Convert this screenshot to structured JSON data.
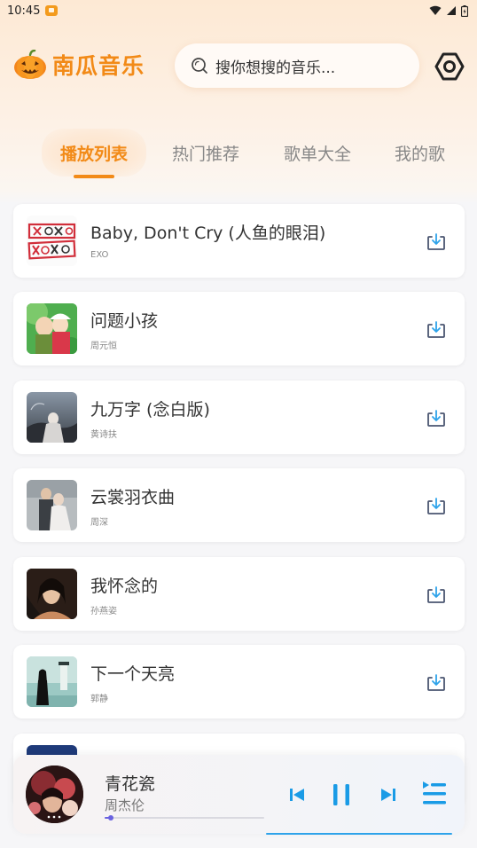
{
  "status_bar": {
    "time": "10:45"
  },
  "app": {
    "name": "南瓜音乐"
  },
  "search": {
    "placeholder": "搜你想搜的音乐..."
  },
  "tabs": [
    {
      "label": "播放列表",
      "active": true
    },
    {
      "label": "热门推荐",
      "active": false
    },
    {
      "label": "歌单大全",
      "active": false
    },
    {
      "label": "我的歌",
      "active": false
    }
  ],
  "songs": [
    {
      "title": "Baby, Don't Cry (人鱼的眼泪)",
      "artist": "EXO"
    },
    {
      "title": "问题小孩",
      "artist": "周元恒"
    },
    {
      "title": "九万字 (念白版)",
      "artist": "黄诗扶"
    },
    {
      "title": "云裳羽衣曲",
      "artist": "周深"
    },
    {
      "title": "我怀念的",
      "artist": "孙燕姿"
    },
    {
      "title": "下一个天亮",
      "artist": "郭静"
    },
    {
      "title": "",
      "artist": ""
    }
  ],
  "player": {
    "title": "青花瓷",
    "artist": "周杰伦",
    "progress": 0.04,
    "state": "playing"
  },
  "colors": {
    "accent": "#f28a17",
    "player_controls": "#1a9be6",
    "progress": "#6a62e0"
  },
  "icons": {
    "search": "search-icon",
    "settings": "settings-icon",
    "download": "download-icon",
    "previous": "previous-icon",
    "pause": "pause-icon",
    "next": "next-icon",
    "playlist": "playlist-icon"
  }
}
